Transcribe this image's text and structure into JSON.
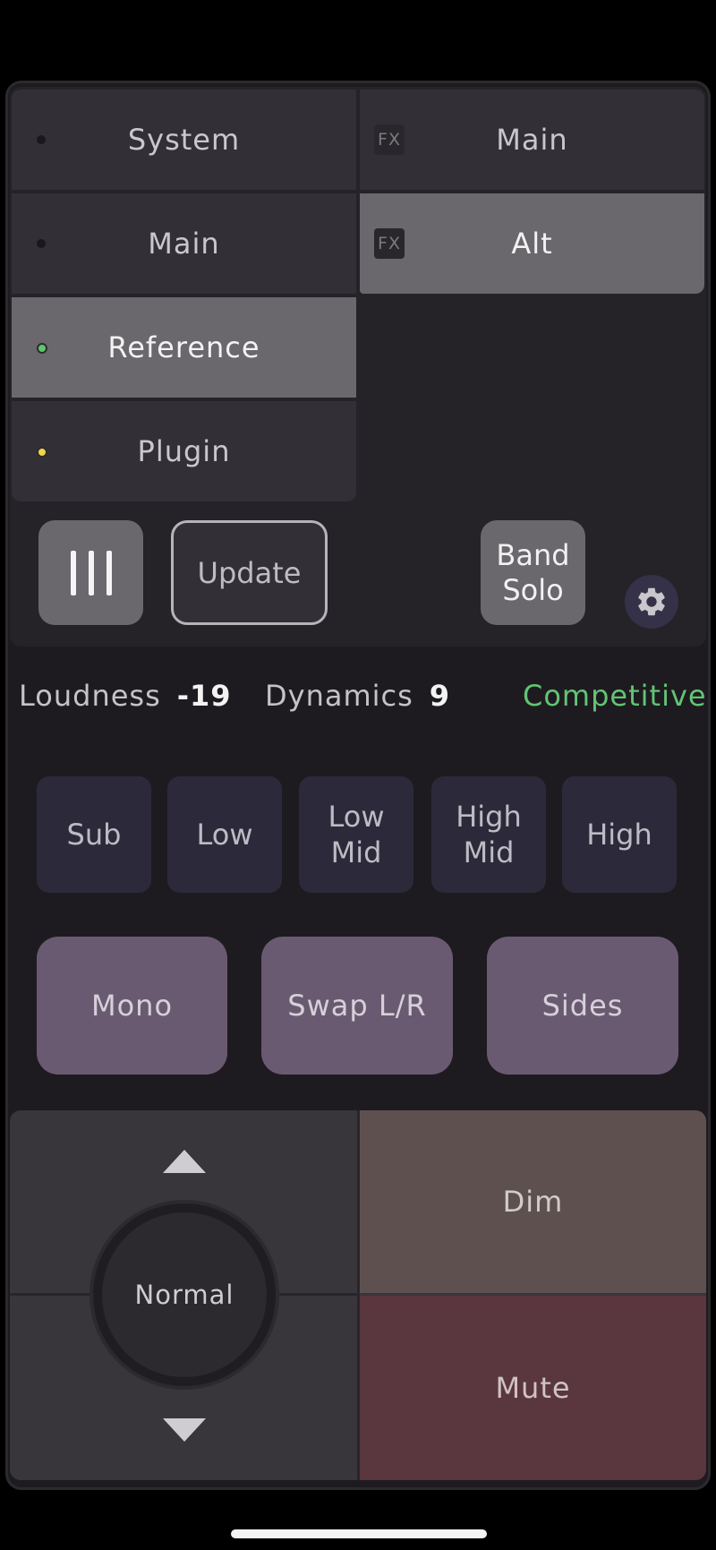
{
  "sources": {
    "left": [
      {
        "label": "System",
        "indicator": "none",
        "active": false
      },
      {
        "label": "Main",
        "indicator": "none",
        "active": false
      },
      {
        "label": "Reference",
        "indicator": "green",
        "active": true
      },
      {
        "label": "Plugin",
        "indicator": "yellow",
        "active": false
      }
    ],
    "right": [
      {
        "label": "Main",
        "badge": "FX",
        "active": false
      },
      {
        "label": "Alt",
        "badge": "FX",
        "active": true
      }
    ]
  },
  "controls": {
    "update_label": "Update",
    "band_solo_line1": "Band",
    "band_solo_line2": "Solo"
  },
  "readouts": {
    "loudness_label": "Loudness",
    "loudness_value": "-19",
    "dynamics_label": "Dynamics",
    "dynamics_value": "9",
    "status": "Competitive",
    "status_color": "#62c474"
  },
  "bands": [
    {
      "line1": "Sub",
      "line2": ""
    },
    {
      "line1": "Low",
      "line2": ""
    },
    {
      "line1": "Low",
      "line2": "Mid"
    },
    {
      "line1": "High",
      "line2": "Mid"
    },
    {
      "line1": "High",
      "line2": ""
    }
  ],
  "modes": [
    "Mono",
    "Swap L/R",
    "Sides"
  ],
  "volume": {
    "knob_label": "Normal",
    "dim_label": "Dim",
    "mute_label": "Mute"
  },
  "colors": {
    "active_source": "#6a686c",
    "mode_button": "#6a5a71",
    "band_button": "#2c2a3a",
    "dim": "#5f5050",
    "mute": "#5a363e"
  }
}
